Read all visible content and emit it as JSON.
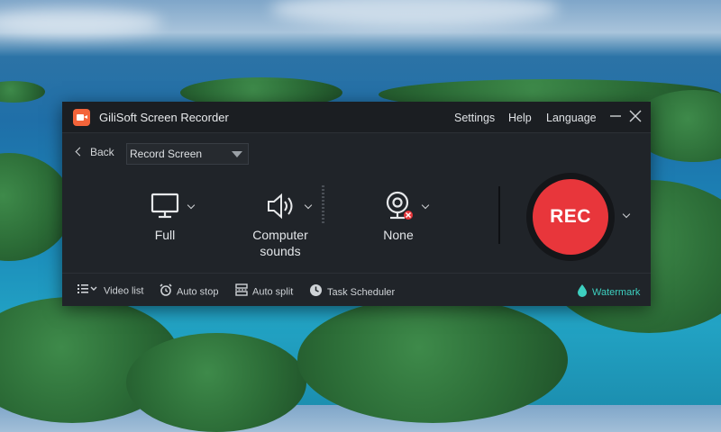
{
  "window": {
    "title": "GiliSoft Screen Recorder",
    "menu": [
      "Settings",
      "Help",
      "Language"
    ]
  },
  "toolbar": {
    "back_label": "Back",
    "mode_select_value": "Record Screen"
  },
  "sources": {
    "screen_label": "Full",
    "audio_label_line1": "Computer",
    "audio_label_line2": "sounds",
    "webcam_label": "None"
  },
  "rec_label": "REC",
  "bottom": {
    "video_list": "Video list",
    "auto_stop": "Auto stop",
    "auto_split": "Auto split",
    "task_scheduler": "Task Scheduler",
    "watermark": "Watermark"
  },
  "colors": {
    "accent_rec": "#e8363b",
    "logo_orange": "#f4643a",
    "watermark_teal": "#3dd0c0",
    "window_bg": "#202429"
  },
  "icons": [
    "camera-logo-icon",
    "minimize-icon",
    "close-icon",
    "chevron-left-icon",
    "dropdown-arrow-icon",
    "monitor-icon",
    "speaker-icon",
    "webcam-icon",
    "list-icon",
    "alarm-clock-icon",
    "split-icon",
    "clock-icon",
    "water-drop-icon"
  ]
}
